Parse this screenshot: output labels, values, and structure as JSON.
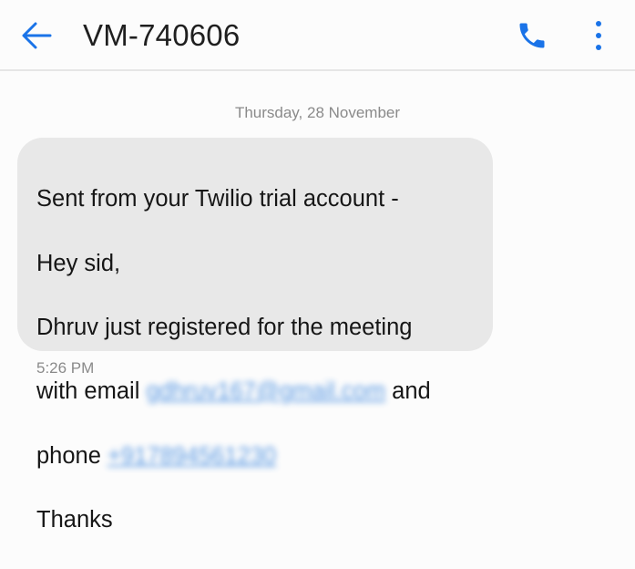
{
  "header": {
    "title": "VM-740606",
    "back_icon": "arrow-left-icon",
    "call_icon": "phone-icon",
    "more_icon": "more-vertical-icon",
    "accent_color": "#1a73e8"
  },
  "conversation": {
    "date_separator": "Thursday, 28 November",
    "message": {
      "line1": "Sent from your Twilio trial account -",
      "line2": "Hey sid,",
      "line3": "Dhruv just registered for the meeting",
      "line4_prefix": "with email",
      "email_text": "gdhruv167@gmail.com",
      "line4_suffix": "and",
      "line5_prefix": "phone",
      "phone_text": "+917894561230",
      "line6": "Thanks",
      "time": "5:26 PM"
    }
  }
}
